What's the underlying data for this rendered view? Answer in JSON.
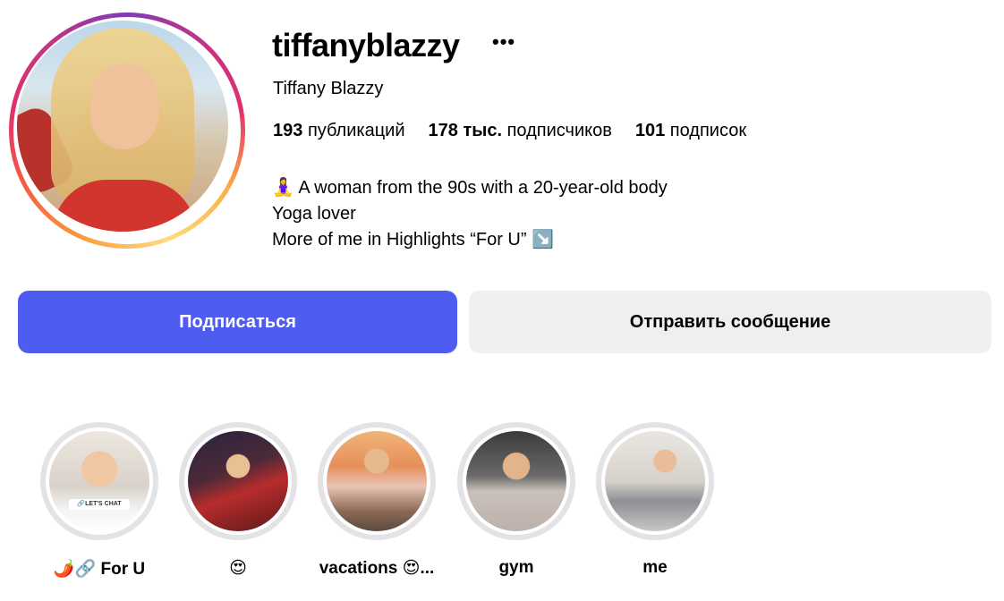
{
  "profile": {
    "username": "tiffanyblazzy",
    "more_icon": "•••",
    "full_name": "Tiffany Blazzy",
    "stats": {
      "posts_count": "193",
      "posts_label": "публикаций",
      "followers_count": "178 тыс.",
      "followers_label": "подписчиков",
      "following_count": "101",
      "following_label": "подписок"
    },
    "bio": [
      "🧘‍♀️ A woman from the 90s with a 20-year-old body",
      "Yoga lover",
      "More of me in Highlights “For U” ↘️"
    ]
  },
  "actions": {
    "follow_label": "Подписаться",
    "message_label": "Отправить сообщение"
  },
  "highlights": [
    {
      "label": "🌶️🔗 For U",
      "badge": "🔗LET'S CHAT MORE🌶️🔗"
    },
    {
      "label": "😍"
    },
    {
      "label": "vacations 😍..."
    },
    {
      "label": "gym"
    },
    {
      "label": "me"
    }
  ],
  "colors": {
    "follow_button": "#4f5cf0",
    "message_button": "#efeff2",
    "highlight_ring": "#e3e3e6"
  }
}
